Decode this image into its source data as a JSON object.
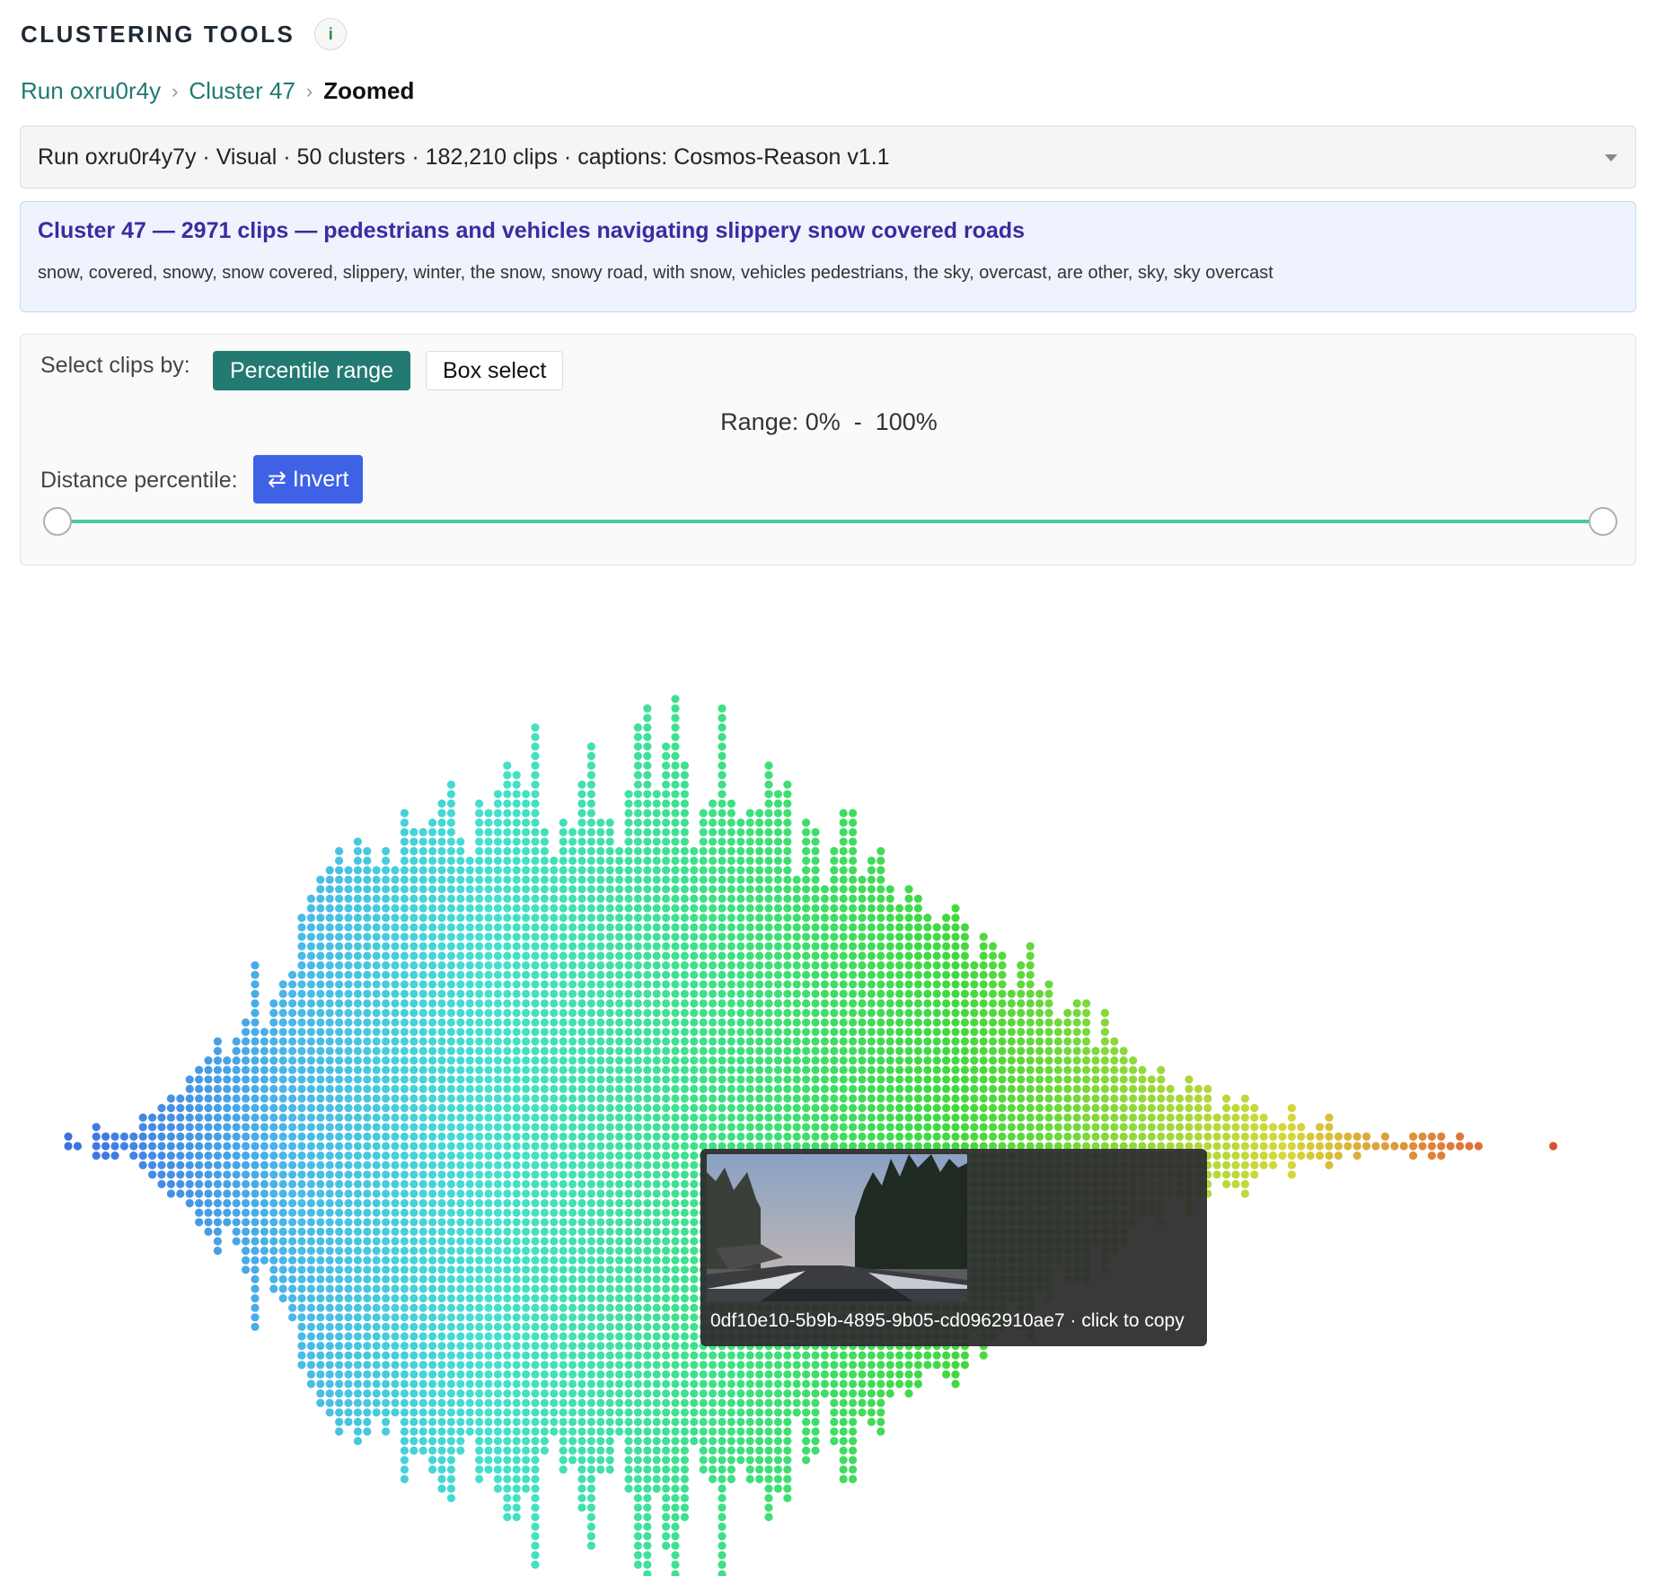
{
  "app": {
    "title": "CLUSTERING TOOLS",
    "info_glyph": "i"
  },
  "breadcrumb": {
    "run": "Run oxru0r4y",
    "cluster": "Cluster 47",
    "current": "Zoomed",
    "separator": "›"
  },
  "run_selector": {
    "value": "Run oxru0r4y7y · Visual · 50 clusters · 182,210 clips · captions: Cosmos-Reason v1.1"
  },
  "cluster": {
    "title": "Cluster 47 — 2971 clips — pedestrians and vehicles navigating slippery snow covered roads",
    "keywords": "snow, covered, snowy, snow covered, slippery, winter, the snow, snowy road, with snow, vehicles pedestrians, the sky, overcast, are other, sky, sky overcast"
  },
  "selection": {
    "label": "Select clips by:",
    "modes": {
      "percentile": "Percentile range",
      "box": "Box select"
    },
    "active_mode": "percentile",
    "range_text": "Range: 0%  -  100%",
    "range_min_pct": 0,
    "range_max_pct": 100,
    "distance_label": "Distance percentile:",
    "invert_label": "⇄ Invert"
  },
  "tooltip": {
    "text": "0df10e10-5b9b-4895-9b05-cd0962910ae7 · click to copy"
  },
  "colors": {
    "accent_teal": "#227a72",
    "invert_blue": "#3e61e6",
    "slider_track": "#49cc98",
    "cluster_title": "#3a2ca0",
    "gradient": [
      "#3f6fe0",
      "#4ab8e8",
      "#45e0cf",
      "#3ee080",
      "#42d83e",
      "#d6d83a",
      "#e07b3a",
      "#d9532b"
    ]
  },
  "chart_data": {
    "type": "scatter",
    "subtype": "beeswarm",
    "x_meaning": "distance percentile",
    "xlim": [
      0,
      100
    ],
    "point_count": 2971,
    "color_scale": "blue → cyan → green → yellow → orange by distance",
    "column_heights": [
      2,
      1,
      0,
      4,
      3,
      3,
      2,
      3,
      6,
      7,
      9,
      11,
      11,
      14,
      17,
      19,
      23,
      18,
      22,
      27,
      39,
      25,
      31,
      34,
      37,
      48,
      52,
      56,
      58,
      62,
      59,
      64,
      62,
      58,
      62,
      58,
      71,
      66,
      66,
      69,
      73,
      76,
      65,
      61,
      72,
      70,
      74,
      80,
      79,
      74,
      89,
      66,
      61,
      69,
      67,
      77,
      85,
      69,
      69,
      62,
      74,
      89,
      93,
      74,
      85,
      94,
      80,
      63,
      70,
      72,
      92,
      72,
      68,
      71,
      71,
      80,
      74,
      76,
      57,
      68,
      66,
      54,
      63,
      71,
      71,
      57,
      60,
      62,
      54,
      51,
      54,
      52,
      48,
      47,
      49,
      51,
      47,
      39,
      45,
      42,
      40,
      33,
      39,
      42,
      32,
      34,
      26,
      29,
      30,
      30,
      21,
      28,
      23,
      21,
      18,
      16,
      15,
      17,
      12,
      11,
      15,
      12,
      12,
      7,
      10,
      9,
      11,
      8,
      6,
      5,
      4,
      8,
      4,
      3,
      4,
      6,
      3,
      2,
      3,
      2,
      1,
      2,
      1,
      1,
      3,
      2,
      3,
      3,
      1,
      2,
      1,
      1,
      0,
      0,
      0,
      0,
      0,
      0,
      0,
      1
    ]
  }
}
